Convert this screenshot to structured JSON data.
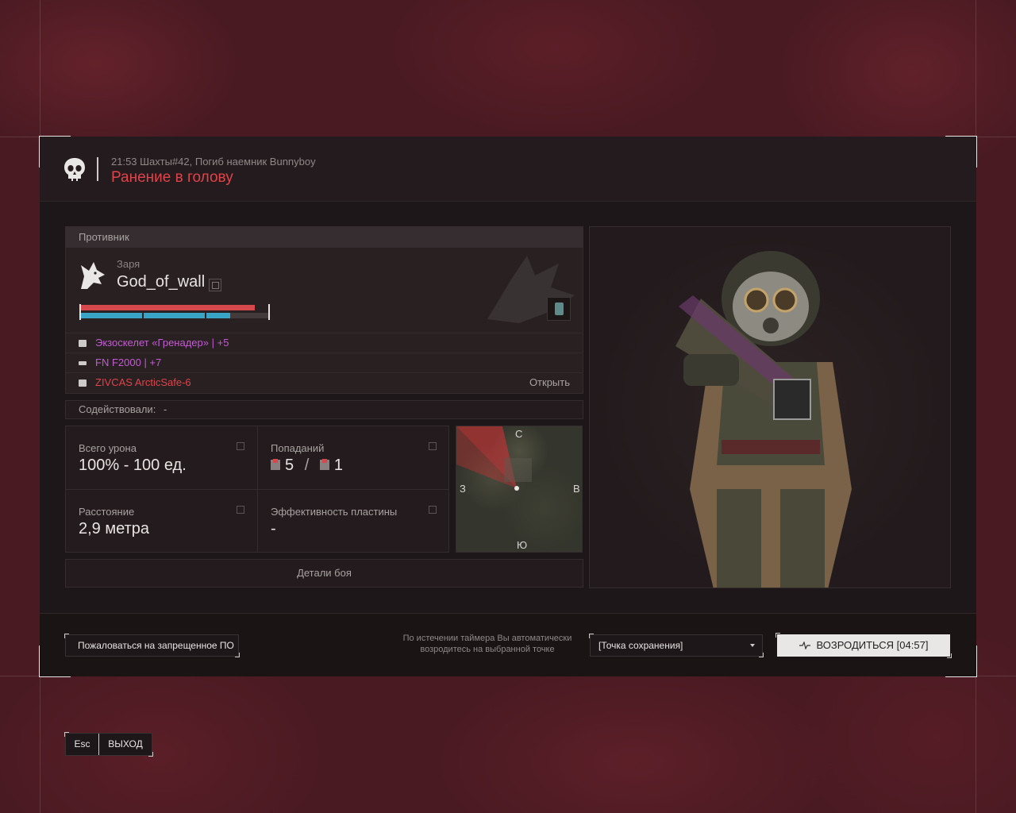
{
  "header": {
    "info": "21:53 Шахты#42, Погиб наемник Bunnyboy",
    "title": "Ранение в голову"
  },
  "enemy": {
    "section_label": "Противник",
    "clan": "Заря",
    "nickname": "God_of_wall",
    "health_fraction": 0.93,
    "armor_fraction": 0.8,
    "equipment": [
      {
        "name": "Экзоскелет «Гренадер»",
        "bonus": "| +5",
        "color": "#c45bd4"
      },
      {
        "name": "FN F2000",
        "bonus": "| +7",
        "color": "#c45bd4"
      },
      {
        "name": "ZIVCAS ArcticSafe-6",
        "bonus": "",
        "color": "#e0434a"
      }
    ],
    "open_label": "Открыть"
  },
  "assist": {
    "label": "Содействовали:",
    "value": "-"
  },
  "stats": {
    "damage_label": "Всего урона",
    "damage_value": "100% - 100 ед.",
    "hits_label": "Попаданий",
    "hits_a": "5",
    "hits_sep": "/",
    "hits_b": "1",
    "distance_label": "Расстояние",
    "distance_value": "2,9 метра",
    "plate_label": "Эффективность пластины",
    "plate_value": "-"
  },
  "minimap": {
    "north": "С",
    "south": "Ю",
    "west": "З",
    "east": "В"
  },
  "details_label": "Детали боя",
  "footer": {
    "report_label": "Пожаловаться на запрещенное ПО",
    "timer_note_1": "По истечении таймера Вы автоматически",
    "timer_note_2": "возродитесь на выбранной точке",
    "spawn_selected": "[Точка сохранения]",
    "respawn_label": "ВОЗРОДИТЬСЯ [04:57]"
  },
  "exit": {
    "key": "Esc",
    "label": "ВЫХОД"
  }
}
